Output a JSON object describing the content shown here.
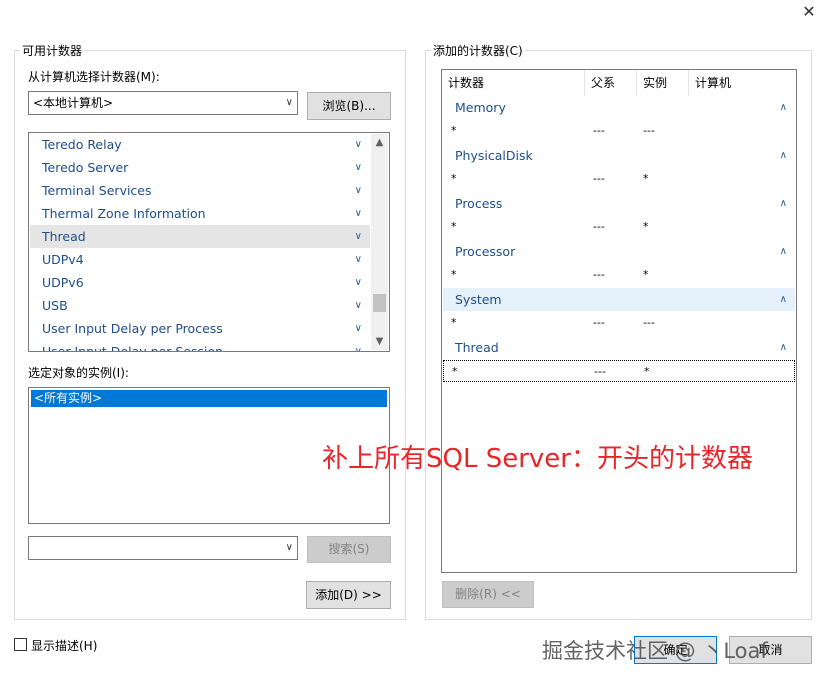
{
  "window": {
    "close_glyph": "✕"
  },
  "left": {
    "group_title": "可用计数器",
    "computer_label": "从计算机选择计数器(M):",
    "computer_value": "<本地计算机>",
    "browse_button": "浏览(B)...",
    "counters": [
      {
        "label": "Teredo Relay",
        "selected": false
      },
      {
        "label": "Teredo Server",
        "selected": false
      },
      {
        "label": "Terminal Services",
        "selected": false
      },
      {
        "label": "Thermal Zone Information",
        "selected": false
      },
      {
        "label": "Thread",
        "selected": true
      },
      {
        "label": "UDPv4",
        "selected": false
      },
      {
        "label": "UDPv6",
        "selected": false
      },
      {
        "label": "USB",
        "selected": false
      },
      {
        "label": "User Input Delay per Process",
        "selected": false
      },
      {
        "label": "User Input Delay per Session",
        "selected": false
      }
    ],
    "instances_label": "选定对象的实例(I):",
    "instances": [
      "<所有实例>"
    ],
    "search_value": "",
    "search_button": "搜索(S)",
    "add_button": "添加(D) >>"
  },
  "right": {
    "group_title": "添加的计数器(C)",
    "columns": [
      "计数器",
      "父系",
      "实例",
      "计算机"
    ],
    "groups": [
      {
        "name": "Memory",
        "selected": false,
        "row": {
          "counter": "*",
          "parent": "---",
          "instance": "---",
          "computer": ""
        }
      },
      {
        "name": "PhysicalDisk",
        "selected": false,
        "row": {
          "counter": "*",
          "parent": "---",
          "instance": "*",
          "computer": ""
        }
      },
      {
        "name": "Process",
        "selected": false,
        "row": {
          "counter": "*",
          "parent": "---",
          "instance": "*",
          "computer": ""
        }
      },
      {
        "name": "Processor",
        "selected": false,
        "row": {
          "counter": "*",
          "parent": "---",
          "instance": "*",
          "computer": ""
        }
      },
      {
        "name": "System",
        "selected": true,
        "row": {
          "counter": "*",
          "parent": "---",
          "instance": "---",
          "computer": ""
        }
      },
      {
        "name": "Thread",
        "selected": false,
        "row": {
          "counter": "*",
          "parent": "---",
          "instance": "*",
          "computer": ""
        }
      }
    ],
    "remove_button": "删除(R) <<"
  },
  "footer": {
    "show_description": "显示描述(H)",
    "show_description_checked": false,
    "ok_button": "确定",
    "cancel_button": "取消"
  },
  "annotation": "补上所有SQL Server：开头的计数器",
  "watermark": "掘金技术社区 @ 丶Loaf",
  "colors": {
    "accent": "#0078d7",
    "annotation": "#e8262a",
    "counter_text": "#1e4e8c",
    "selected_group_bg": "#e5f1fb"
  }
}
